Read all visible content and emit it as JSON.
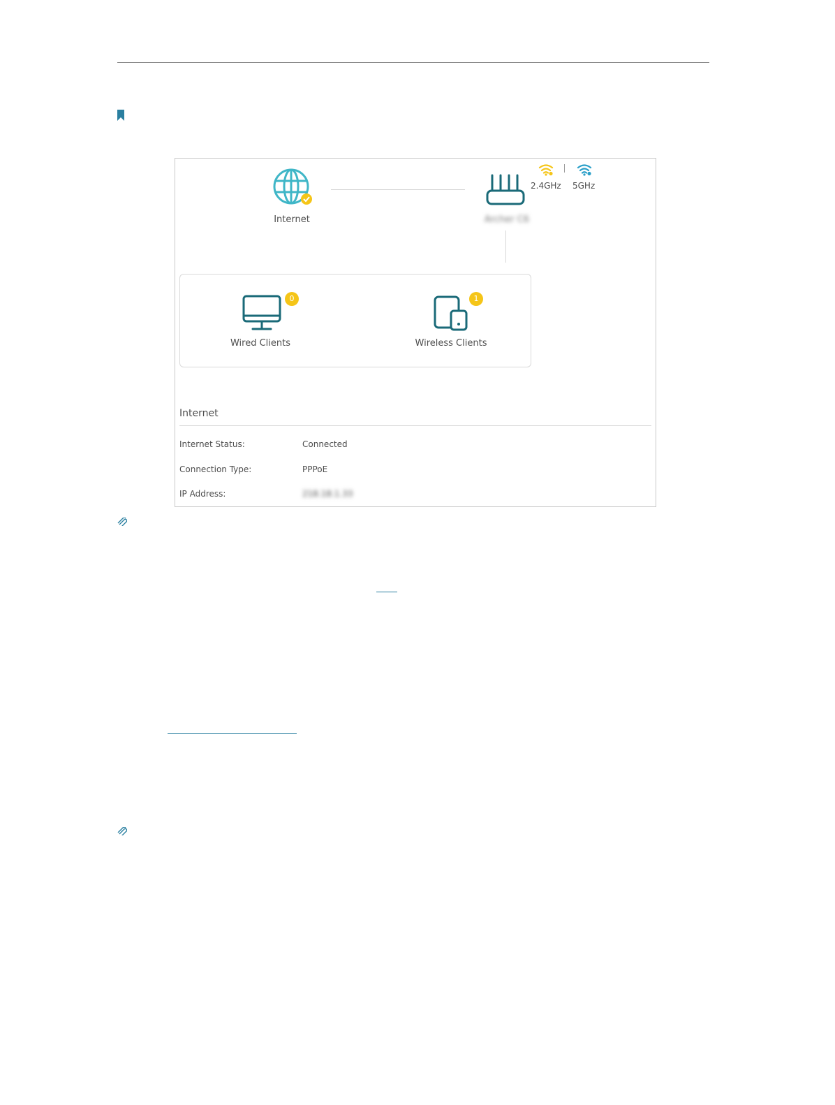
{
  "network_map": {
    "internet_node": {
      "label": "Internet",
      "icon": "globe-icon",
      "status_icon": "check-badge-icon"
    },
    "router_node": {
      "label": "Archer C6",
      "icon": "router-icon"
    },
    "bands": [
      {
        "label": "2.4GHz",
        "icon": "wifi-icon",
        "color": "#f5c518"
      },
      {
        "label": "5GHz",
        "icon": "wifi-icon",
        "color": "#2a9fc8"
      }
    ],
    "clients": [
      {
        "label": "Wired Clients",
        "count": "0",
        "icon": "monitor-icon"
      },
      {
        "label": "Wireless Clients",
        "count": "1",
        "icon": "tablet-phone-icon"
      }
    ]
  },
  "internet_section": {
    "title": "Internet",
    "rows": [
      {
        "label": "Internet Status:",
        "value": "Connected"
      },
      {
        "label": "Connection Type:",
        "value": "PPPoE"
      },
      {
        "label": "IP Address:",
        "value": "218.18.1.33"
      }
    ]
  },
  "colors": {
    "accent_teal": "#1a6a78",
    "globe_teal": "#3fb6c7",
    "badge_yellow": "#f5c518",
    "note_icon_blue": "#2a7fa0"
  }
}
